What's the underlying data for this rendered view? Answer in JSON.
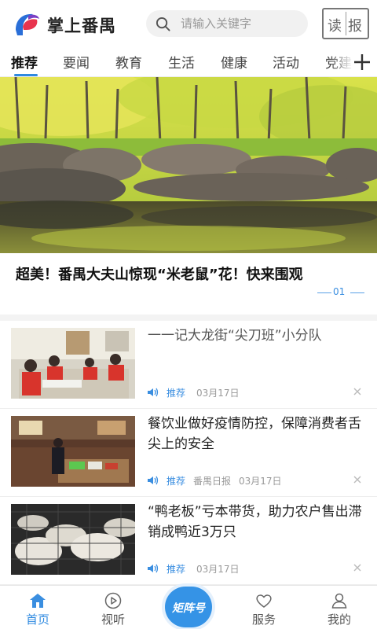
{
  "header": {
    "app_title": "掌上番禺",
    "search_placeholder": "请输入关键字",
    "read_paper": [
      "读",
      "报"
    ]
  },
  "tabs": [
    {
      "label": "推荐",
      "active": true
    },
    {
      "label": "要闻"
    },
    {
      "label": "教育"
    },
    {
      "label": "生活"
    },
    {
      "label": "健康"
    },
    {
      "label": "活动"
    },
    {
      "label": "党建"
    }
  ],
  "banner": {
    "title": "超美！番禺大夫山惊现“米老鼠”花！快来围观",
    "page": "01"
  },
  "news": [
    {
      "title": "一一记大龙街“尖刀班”小分队",
      "tag": "推荐",
      "source": "",
      "date": "03月17日"
    },
    {
      "title": "餐饮业做好疫情防控，保障消费者舌尖上的安全",
      "tag": "推荐",
      "source": "番禺日报",
      "date": "03月17日"
    },
    {
      "title": "“鸭老板”亏本带货，助力农户售出滞销成鸭近3万只",
      "tag": "推荐",
      "source": "",
      "date": "03月17日"
    }
  ],
  "bottom_nav": [
    {
      "label": "首页",
      "icon": "home-icon",
      "active": true
    },
    {
      "label": "视听",
      "icon": "play-icon"
    },
    {
      "label": "矩阵号",
      "icon": "matrix-button"
    },
    {
      "label": "服务",
      "icon": "heart-icon"
    },
    {
      "label": "我的",
      "icon": "user-icon"
    }
  ],
  "colors": {
    "accent": "#2f8ae0",
    "center_button": "#3593e6"
  }
}
